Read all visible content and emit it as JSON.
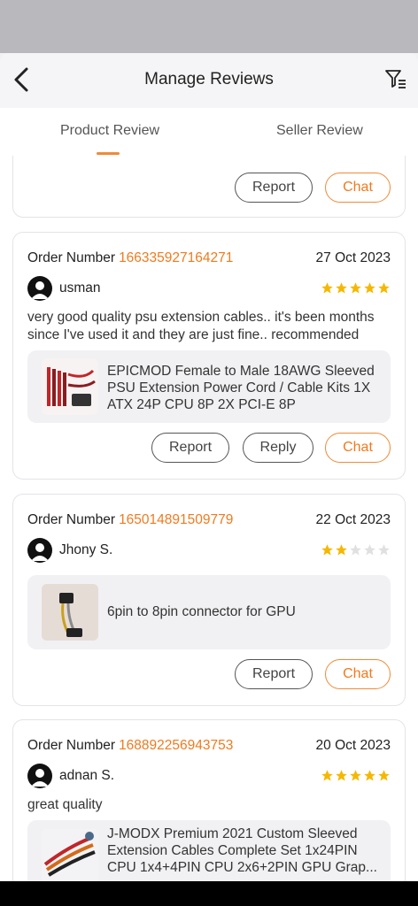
{
  "header": {
    "title": "Manage Reviews"
  },
  "tabs": [
    {
      "label": "Product Review"
    },
    {
      "label": "Seller Review"
    }
  ],
  "buttons": {
    "report": "Report",
    "reply": "Reply",
    "chat": "Chat"
  },
  "order_label": "Order Number",
  "reviews": [
    {
      "order_number": "166335927164271",
      "date": "27 Oct 2023",
      "user": "usman",
      "rating": 5,
      "comment": "very good quality psu extension cables.. it's been months since I've used it and they are just fine.. recommended",
      "product": "EPICMOD Female to Male 18AWG Sleeved PSU Extension Power Cord / Cable Kits 1X ATX 24P CPU 8P 2X PCI-E 8P"
    },
    {
      "order_number": "165014891509779",
      "date": "22 Oct 2023",
      "user": "Jhony S.",
      "rating": 2,
      "comment": "",
      "product": "6pin to 8pin connector for GPU"
    },
    {
      "order_number": "168892256943753",
      "date": "20 Oct 2023",
      "user": "adnan S.",
      "rating": 5,
      "comment": "great quality",
      "product": "J-MODX Premium 2021 Custom Sleeved Extension Cables Complete Set 1x24PIN CPU 1x4+4PIN CPU 2x6+2PIN GPU Grap..."
    }
  ],
  "colors": {
    "accent": "#f07a1e",
    "star": "#f5b800",
    "star_empty": "#e0e0e0"
  }
}
